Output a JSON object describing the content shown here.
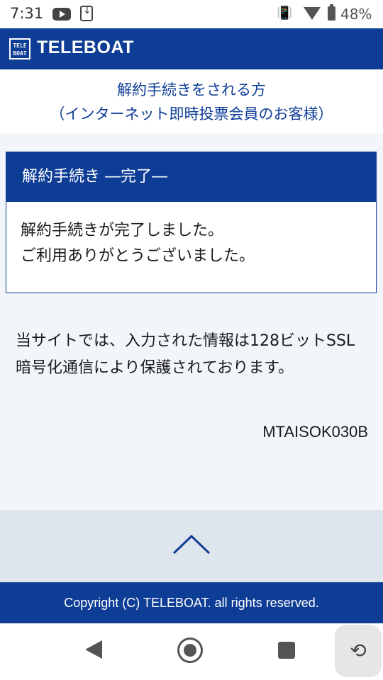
{
  "status_bar": {
    "time": "7:31",
    "battery": "48%",
    "icons": [
      "youtube-icon",
      "download-icon",
      "vibrate-icon",
      "wifi-icon",
      "battery-icon"
    ]
  },
  "header": {
    "logo_text": "TELE BOAT",
    "brand": "TELEBOAT"
  },
  "page": {
    "title_line1": "解約手続きをされる方",
    "title_line2": "（インターネット即時投票会員のお客様）"
  },
  "panel": {
    "title": "解約手続き ―完了―",
    "line1": "解約手続きが完了しました。",
    "line2": "ご利用ありがとうございました。"
  },
  "notice": {
    "text": "当サイトでは、入力された情報は128ビットSSL暗号化通信により保護されております。",
    "code": "MTAISOK030B"
  },
  "footer": {
    "copyright": "Copyright (C) TELEBOAT. all rights reserved."
  },
  "nav": {
    "icons": [
      "back-icon",
      "home-icon",
      "recents-icon",
      "rotate-icon"
    ]
  },
  "colors": {
    "brand_blue": "#0e3d96",
    "page_bg": "#f2f6fb",
    "totop_bg": "#dfe5ed"
  }
}
